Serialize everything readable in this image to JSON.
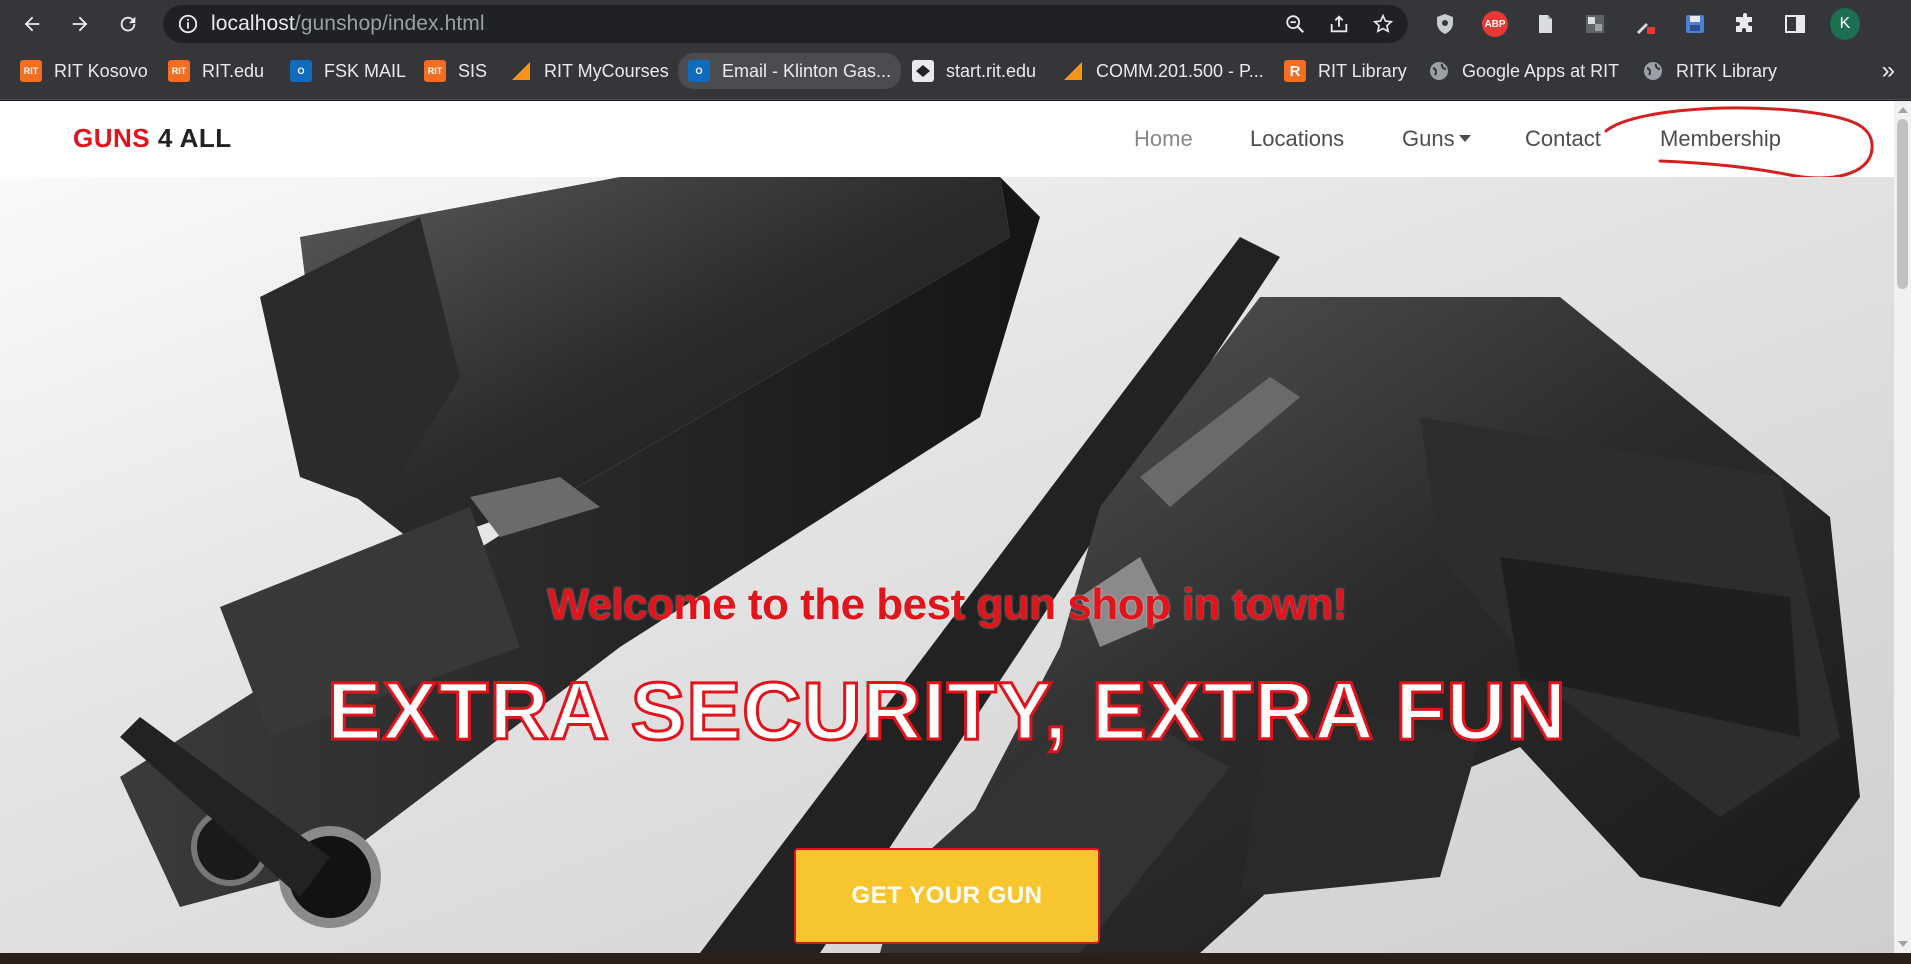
{
  "browser": {
    "url_host": "localhost",
    "url_path": "/gunshop/index.html",
    "profile_initial": "K",
    "abp_label": "ABP"
  },
  "bookmarks": [
    {
      "label": "RIT Kosovo",
      "icon": "rit-icon",
      "icon_text": "RIT"
    },
    {
      "label": "RIT.edu",
      "icon": "rit-icon",
      "icon_text": "RIT"
    },
    {
      "label": "FSK MAIL",
      "icon": "outlook-icon",
      "icon_text": "O"
    },
    {
      "label": "SIS",
      "icon": "rit-icon",
      "icon_text": "RIT"
    },
    {
      "label": "RIT MyCourses",
      "icon": "d2l-icon",
      "icon_text": ""
    },
    {
      "label": "Email - Klinton Gas...",
      "icon": "outlook-icon",
      "icon_text": "O"
    },
    {
      "label": "start.rit.edu",
      "icon": "tiger-icon",
      "icon_text": ""
    },
    {
      "label": "COMM.201.500 - P...",
      "icon": "d2l-icon",
      "icon_text": ""
    },
    {
      "label": "RIT Library",
      "icon": "library-icon",
      "icon_text": "R"
    },
    {
      "label": "Google Apps at RIT",
      "icon": "globe-icon",
      "icon_text": ""
    },
    {
      "label": "RITK Library",
      "icon": "globe-icon",
      "icon_text": ""
    }
  ],
  "site": {
    "brand_part1": "GUNS",
    "brand_part2": "4 ALL",
    "nav": [
      "Home",
      "Locations",
      "Guns",
      "Contact",
      "Membership"
    ],
    "welcome": "Welcome to the best gun shop in town!",
    "headline": "EXTRA SECURITY, EXTRA FUN",
    "cta": "GET YOUR GUN"
  },
  "colors": {
    "brand_red": "#e3131b",
    "cta_yellow": "#f7c52e",
    "chrome_dark": "#35363a"
  }
}
